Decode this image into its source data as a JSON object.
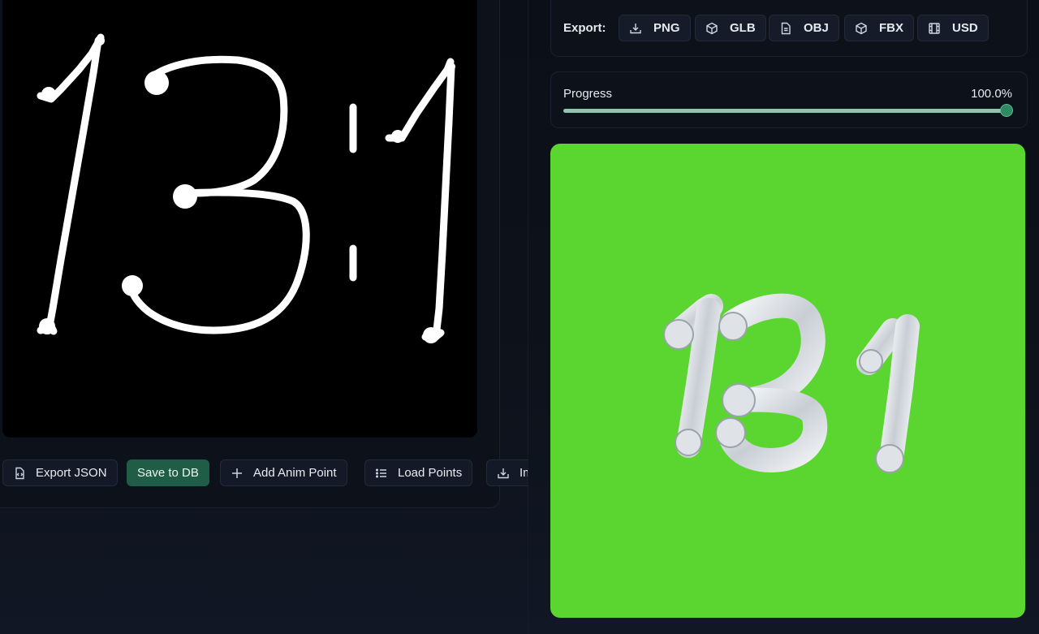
{
  "toolbar": {
    "items": [
      {
        "label": "Export JSON",
        "icon": "file-code-icon"
      },
      {
        "label": "Save to DB",
        "icon": ""
      },
      {
        "label": "Add Anim Point",
        "icon": "plus-icon"
      },
      {
        "label": "Load Points",
        "icon": "list-icon"
      },
      {
        "label": "Import",
        "icon": "import-icon"
      }
    ]
  },
  "export": {
    "label": "Export:",
    "formats": [
      {
        "label": "PNG",
        "icon": "download-icon"
      },
      {
        "label": "GLB",
        "icon": "cube-icon"
      },
      {
        "label": "OBJ",
        "icon": "file-icon"
      },
      {
        "label": "FBX",
        "icon": "cube-icon"
      },
      {
        "label": "USD",
        "icon": "film-icon"
      }
    ]
  },
  "progress": {
    "label": "Progress",
    "value_text": "100.0%",
    "fraction": 1.0
  },
  "colors": {
    "accent": "#1f5d46",
    "progress_fill": "#8cc7ad",
    "preview_background": "#5bd630",
    "canvas_background": "#000000"
  }
}
